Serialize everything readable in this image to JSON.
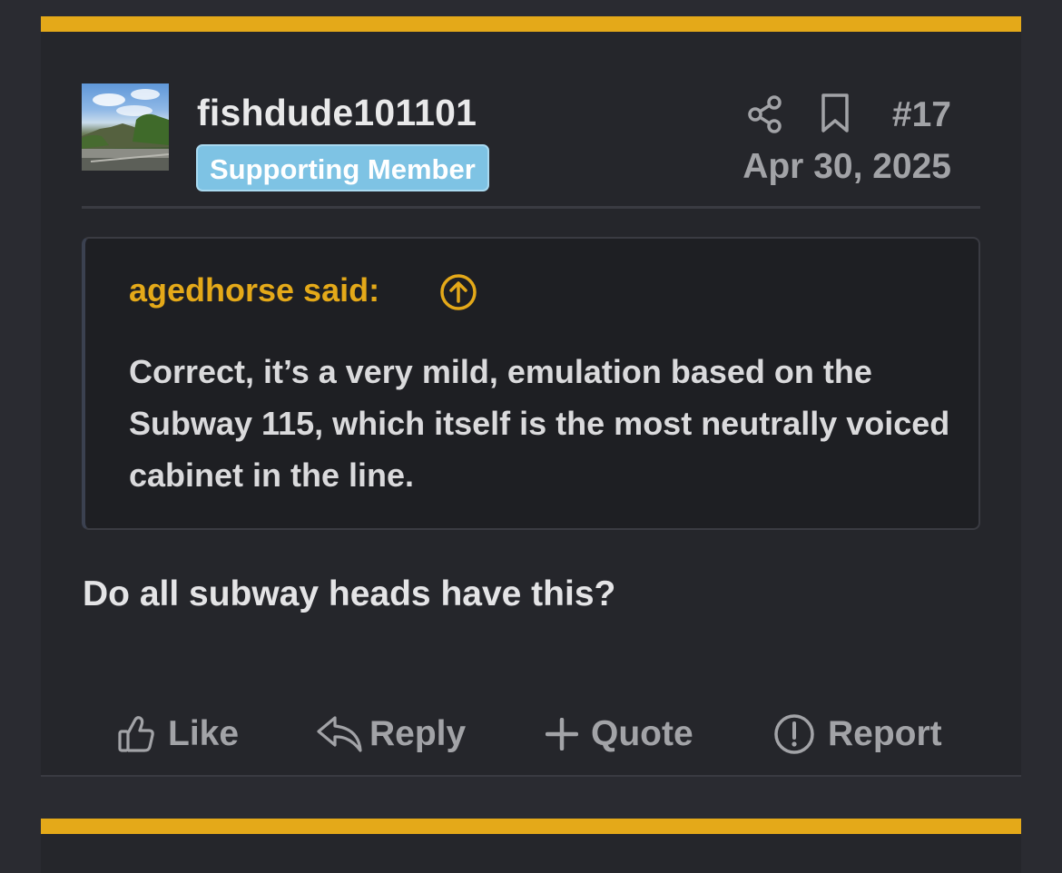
{
  "post": {
    "username": "fishdude101101",
    "badge": "Supporting Member",
    "number": "#17",
    "date": "Apr 30, 2025",
    "body": "Do all subway heads have this?"
  },
  "quote": {
    "author": "agedhorse said:",
    "text": "Correct, it’s a very mild, emulation based on the Subway 115, which itself is the most neutrally voiced cabinet in the line."
  },
  "actions": {
    "like": "Like",
    "reply": "Reply",
    "quote": "Quote",
    "report": "Report"
  },
  "icons": {
    "share": "share-icon",
    "bookmark": "bookmark-icon",
    "quote_jump": "arrow-up-circle-icon",
    "like": "thumbs-up-icon",
    "reply": "reply-arrow-icon",
    "quote": "plus-icon",
    "report": "exclamation-circle-icon"
  },
  "colors": {
    "accent": "#e4a919",
    "badge": "#7ec3e4",
    "background": "#25262b",
    "muted_text": "#a2a3a7"
  }
}
